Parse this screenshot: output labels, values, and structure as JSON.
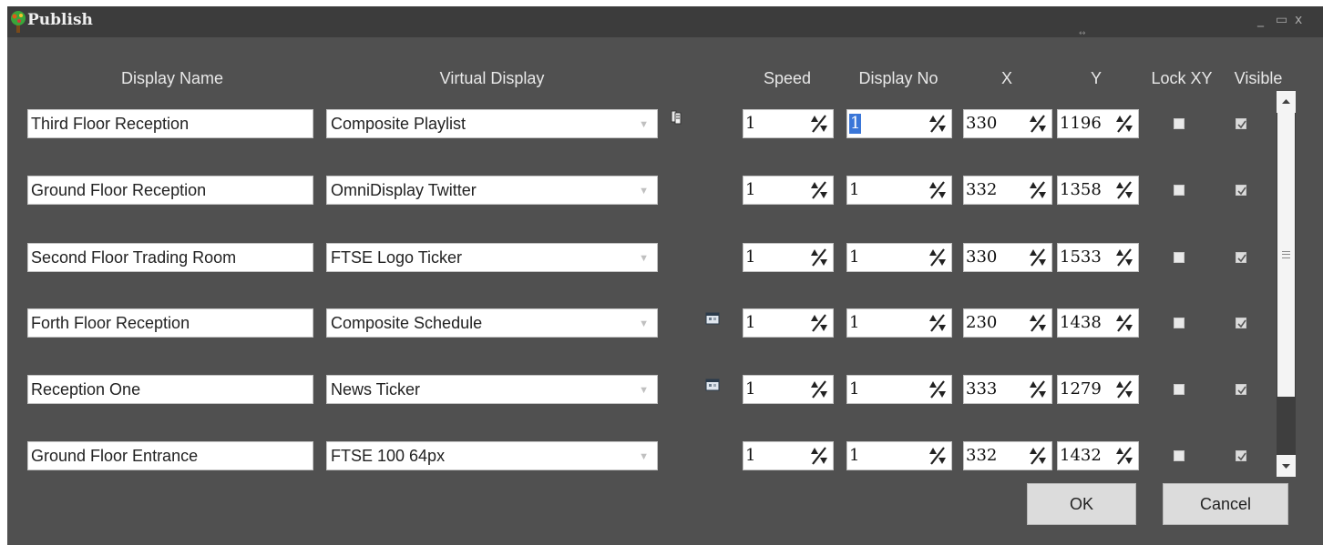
{
  "window": {
    "title": "Publish",
    "minimize_glyph": "_",
    "maximize_glyph": "▭",
    "close_glyph": "x"
  },
  "headers": {
    "display_name": "Display Name",
    "virtual_display": "Virtual Display",
    "speed": "Speed",
    "display_no": "Display No",
    "x": "X",
    "y": "Y",
    "lock_xy": "Lock XY",
    "visible": "Visible"
  },
  "rows": [
    {
      "display_name": "Third Floor Reception",
      "virtual_display": "Composite Playlist",
      "icon": "playlist-icon",
      "speed": "1",
      "display_no": "1",
      "x": "330",
      "y": "1196",
      "lock_xy": false,
      "visible": true
    },
    {
      "display_name": "Ground Floor Reception",
      "virtual_display": "OmniDisplay Twitter",
      "icon": "",
      "speed": "1",
      "display_no": "1",
      "x": "332",
      "y": "1358",
      "lock_xy": false,
      "visible": true
    },
    {
      "display_name": "Second Floor Trading Room",
      "virtual_display": "FTSE Logo Ticker",
      "icon": "",
      "speed": "1",
      "display_no": "1",
      "x": "330",
      "y": "1533",
      "lock_xy": false,
      "visible": true
    },
    {
      "display_name": "Forth Floor Reception",
      "virtual_display": "Composite Schedule",
      "icon": "schedule-icon",
      "speed": "1",
      "display_no": "1",
      "x": "230",
      "y": "1438",
      "lock_xy": false,
      "visible": true
    },
    {
      "display_name": "Reception One",
      "virtual_display": "News Ticker",
      "icon": "schedule-icon",
      "speed": "1",
      "display_no": "1",
      "x": "333",
      "y": "1279",
      "lock_xy": false,
      "visible": true
    },
    {
      "display_name": "Ground Floor Entrance",
      "virtual_display": "FTSE 100 64px",
      "icon": "",
      "speed": "1",
      "display_no": "1",
      "x": "332",
      "y": "1432",
      "lock_xy": false,
      "visible": true
    }
  ],
  "buttons": {
    "ok": "OK",
    "cancel": "Cancel"
  },
  "colors": {
    "window_bg": "#505050",
    "titlebar_bg": "#3c3c3c",
    "selection": "#3a76d8"
  }
}
